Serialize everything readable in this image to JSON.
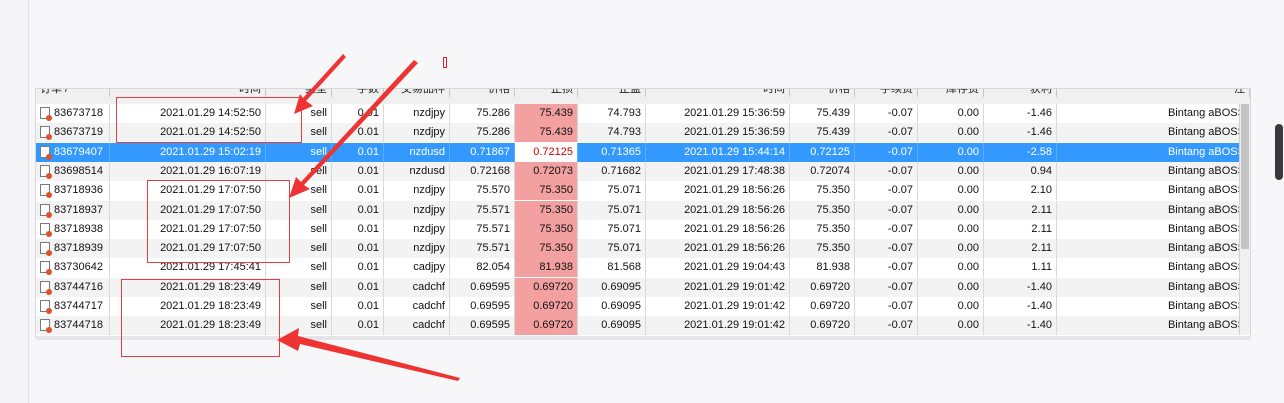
{
  "columns": [
    "订单 /",
    "时间",
    "类型",
    "手数",
    "交易品种",
    "价格",
    "止损",
    "止盈",
    "时间",
    "价格",
    "手续费",
    "库存费",
    "获利",
    "注"
  ],
  "rows": [
    {
      "order": "83673718",
      "open_time": "2021.01.29 14:52:50",
      "type": "sell",
      "lots": "0.01",
      "symbol": "nzdjpy",
      "open_price": "75.286",
      "sl": "75.439",
      "tp": "74.793",
      "close_time": "2021.01.29 15:36:59",
      "close_price": "75.439",
      "commission": "-0.07",
      "swap": "0.00",
      "profit": "-1.46",
      "comment": "Bintang aBOSS"
    },
    {
      "order": "83673719",
      "open_time": "2021.01.29 14:52:50",
      "type": "sell",
      "lots": "0.01",
      "symbol": "nzdjpy",
      "open_price": "75.286",
      "sl": "75.439",
      "tp": "74.793",
      "close_time": "2021.01.29 15:36:59",
      "close_price": "75.439",
      "commission": "-0.07",
      "swap": "0.00",
      "profit": "-1.46",
      "comment": "Bintang aBOSS"
    },
    {
      "order": "83679407",
      "open_time": "2021.01.29 15:02:19",
      "type": "sell",
      "lots": "0.01",
      "symbol": "nzdusd",
      "open_price": "0.71867",
      "sl": "0.72125",
      "tp": "0.71365",
      "close_time": "2021.01.29 15:44:14",
      "close_price": "0.72125",
      "commission": "-0.07",
      "swap": "0.00",
      "profit": "-2.58",
      "comment": "Bintang aBOSS"
    },
    {
      "order": "83698514",
      "open_time": "2021.01.29 16:07:19",
      "type": "sell",
      "lots": "0.01",
      "symbol": "nzdusd",
      "open_price": "0.72168",
      "sl": "0.72073",
      "tp": "0.71682",
      "close_time": "2021.01.29 17:48:38",
      "close_price": "0.72074",
      "commission": "-0.07",
      "swap": "0.00",
      "profit": "0.94",
      "comment": "Bintang aBOSS"
    },
    {
      "order": "83718936",
      "open_time": "2021.01.29 17:07:50",
      "type": "sell",
      "lots": "0.01",
      "symbol": "nzdjpy",
      "open_price": "75.570",
      "sl": "75.350",
      "tp": "75.071",
      "close_time": "2021.01.29 18:56:26",
      "close_price": "75.350",
      "commission": "-0.07",
      "swap": "0.00",
      "profit": "2.10",
      "comment": "Bintang aBOSS"
    },
    {
      "order": "83718937",
      "open_time": "2021.01.29 17:07:50",
      "type": "sell",
      "lots": "0.01",
      "symbol": "nzdjpy",
      "open_price": "75.571",
      "sl": "75.350",
      "tp": "75.071",
      "close_time": "2021.01.29 18:56:26",
      "close_price": "75.350",
      "commission": "-0.07",
      "swap": "0.00",
      "profit": "2.11",
      "comment": "Bintang aBOSS"
    },
    {
      "order": "83718938",
      "open_time": "2021.01.29 17:07:50",
      "type": "sell",
      "lots": "0.01",
      "symbol": "nzdjpy",
      "open_price": "75.571",
      "sl": "75.350",
      "tp": "75.071",
      "close_time": "2021.01.29 18:56:26",
      "close_price": "75.350",
      "commission": "-0.07",
      "swap": "0.00",
      "profit": "2.11",
      "comment": "Bintang aBOSS"
    },
    {
      "order": "83718939",
      "open_time": "2021.01.29 17:07:50",
      "type": "sell",
      "lots": "0.01",
      "symbol": "nzdjpy",
      "open_price": "75.571",
      "sl": "75.350",
      "tp": "75.071",
      "close_time": "2021.01.29 18:56:26",
      "close_price": "75.350",
      "commission": "-0.07",
      "swap": "0.00",
      "profit": "2.11",
      "comment": "Bintang aBOSS"
    },
    {
      "order": "83730642",
      "open_time": "2021.01.29 17:45:41",
      "type": "sell",
      "lots": "0.01",
      "symbol": "cadjpy",
      "open_price": "82.054",
      "sl": "81.938",
      "tp": "81.568",
      "close_time": "2021.01.29 19:04:43",
      "close_price": "81.938",
      "commission": "-0.07",
      "swap": "0.00",
      "profit": "1.11",
      "comment": "Bintang aBOSS"
    },
    {
      "order": "83744716",
      "open_time": "2021.01.29 18:23:49",
      "type": "sell",
      "lots": "0.01",
      "symbol": "cadchf",
      "open_price": "0.69595",
      "sl": "0.69720",
      "tp": "0.69095",
      "close_time": "2021.01.29 19:01:42",
      "close_price": "0.69720",
      "commission": "-0.07",
      "swap": "0.00",
      "profit": "-1.40",
      "comment": "Bintang aBOSS"
    },
    {
      "order": "83744717",
      "open_time": "2021.01.29 18:23:49",
      "type": "sell",
      "lots": "0.01",
      "symbol": "cadchf",
      "open_price": "0.69595",
      "sl": "0.69720",
      "tp": "0.69095",
      "close_time": "2021.01.29 19:01:42",
      "close_price": "0.69720",
      "commission": "-0.07",
      "swap": "0.00",
      "profit": "-1.40",
      "comment": "Bintang aBOSS"
    },
    {
      "order": "83744718",
      "open_time": "2021.01.29 18:23:49",
      "type": "sell",
      "lots": "0.01",
      "symbol": "cadchf",
      "open_price": "0.69595",
      "sl": "0.69720",
      "tp": "0.69095",
      "close_time": "2021.01.29 19:01:42",
      "close_price": "0.69720",
      "commission": "-0.07",
      "swap": "0.00",
      "profit": "-1.40",
      "comment": "Bintang aBOSS"
    }
  ],
  "selected_order": "83679407",
  "colors": {
    "selected_row": "#3399ff",
    "stoploss_cell": "#f3a0a0",
    "annotation_red": "#e04040"
  },
  "icons": {
    "row_icon": "order-document-icon"
  }
}
